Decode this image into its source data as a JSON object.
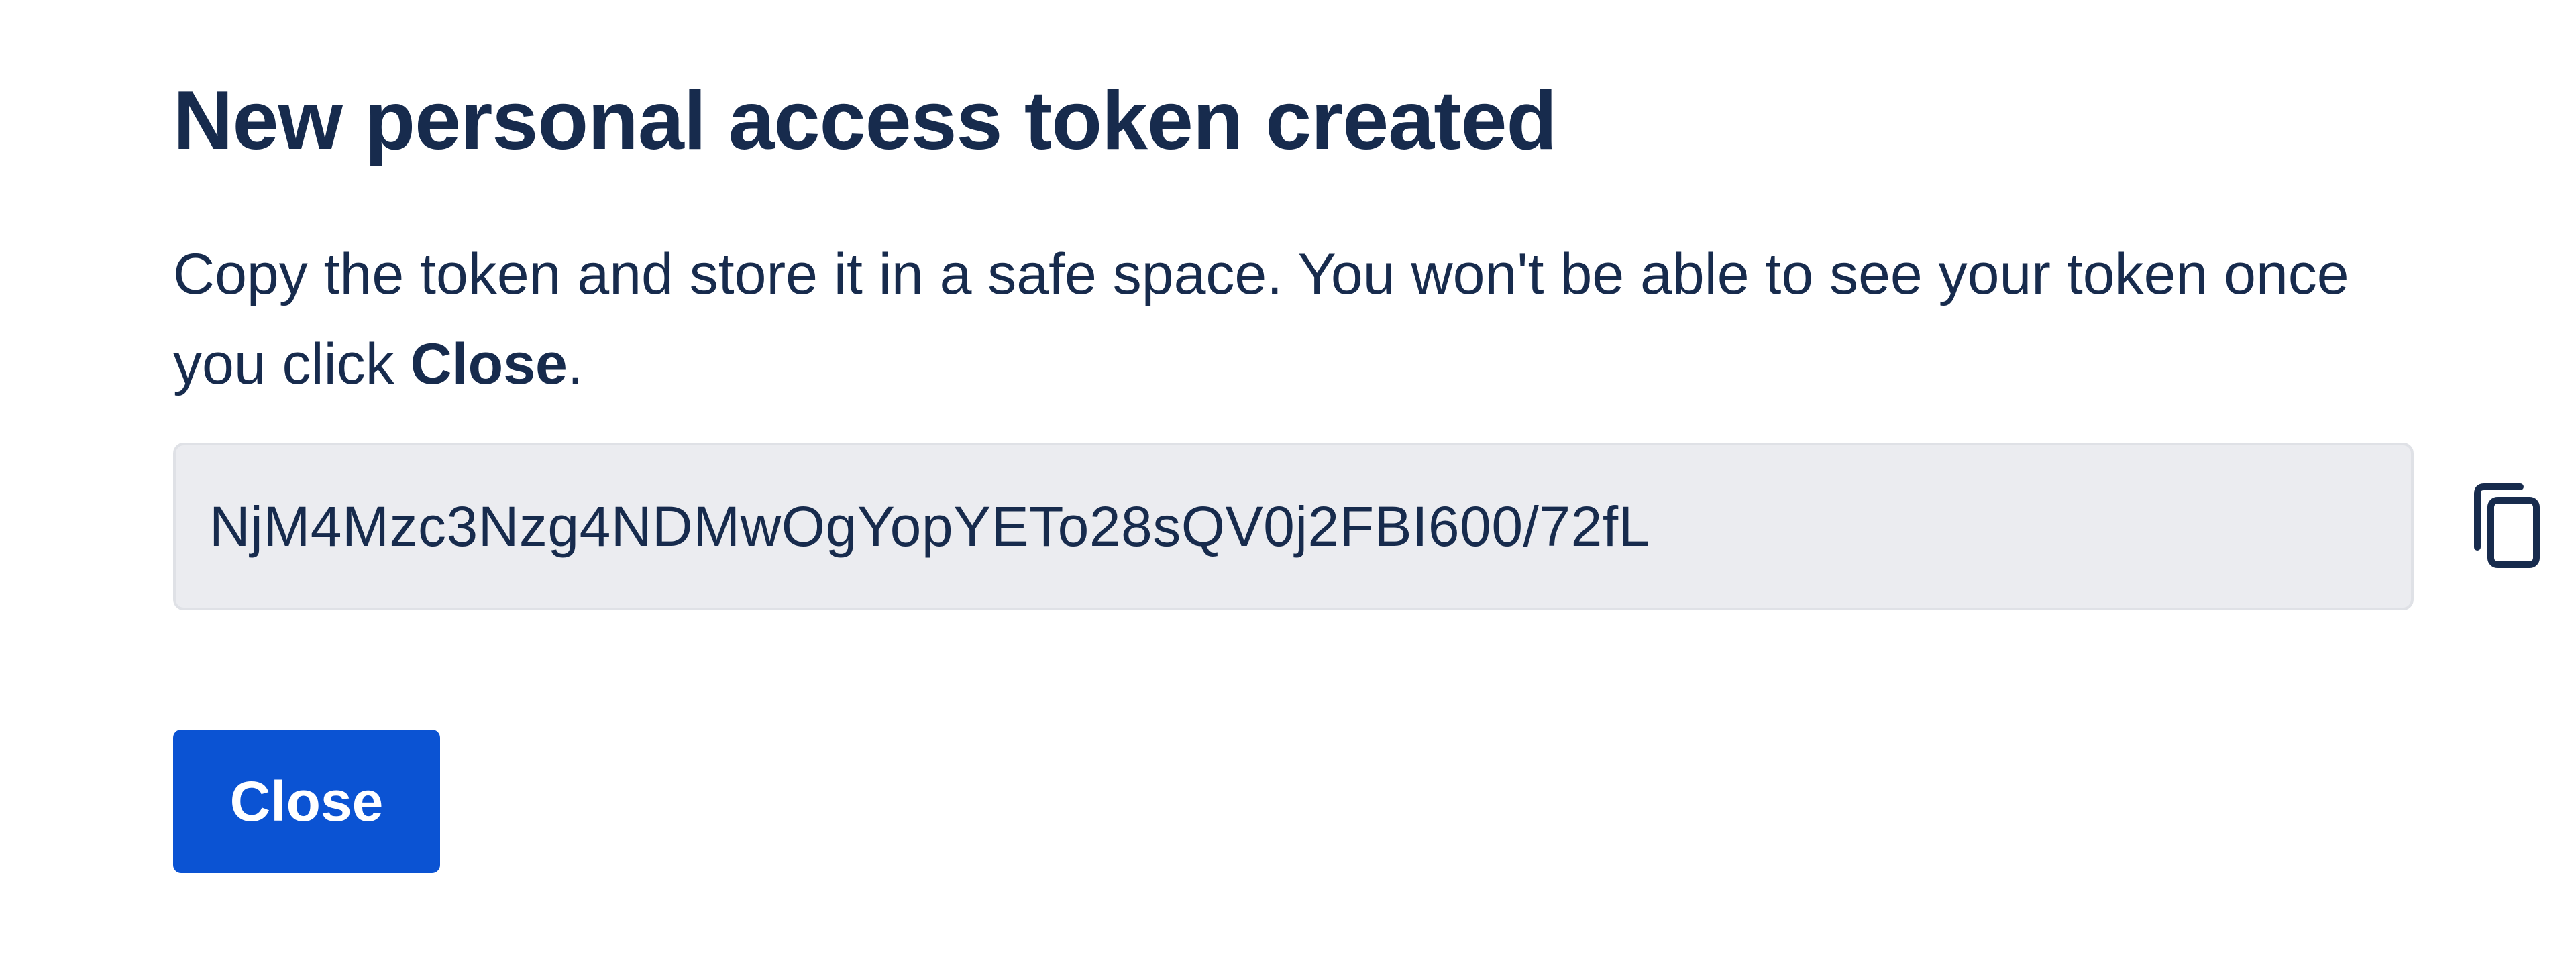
{
  "dialog": {
    "title": "New personal access token created",
    "message": {
      "text_before": "Copy the token and store it in a safe space. You won't be able to see your token once you click ",
      "emphasis": "Close",
      "text_after": "."
    },
    "token": {
      "value": "NjM4Mzc3Nzg4NDMwOgYopYETo28sQV0j2FBI600/72fL"
    },
    "copy_icon": "copy-icon",
    "close_button_label": "Close",
    "colors": {
      "primary": "#0b53d3",
      "text": "#172b4d",
      "field_background": "#ebecf0"
    }
  }
}
